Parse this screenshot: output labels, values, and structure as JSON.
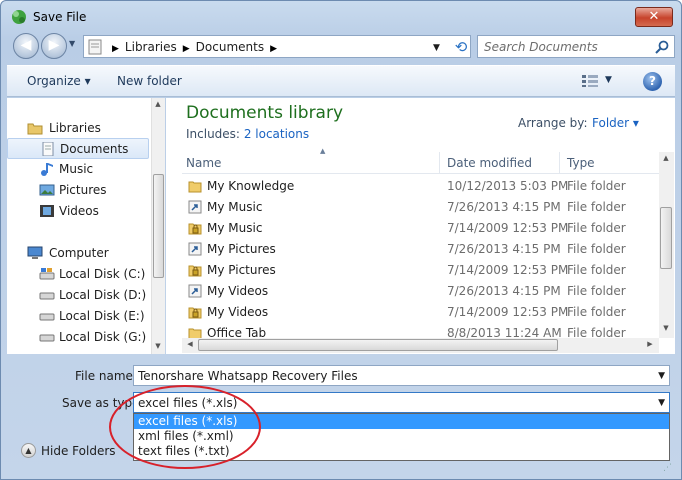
{
  "window": {
    "title": "Save File",
    "close_label": "✕"
  },
  "address_bar": {
    "segments": [
      "Libraries",
      "Documents"
    ],
    "search_placeholder": "Search Documents"
  },
  "toolbar": {
    "organize_label": "Organize",
    "new_folder_label": "New folder",
    "help_label": "?"
  },
  "nav_pane": {
    "items": [
      {
        "label": "Libraries",
        "icon": "libraries-icon"
      },
      {
        "label": "Documents",
        "icon": "documents-icon",
        "selected": true
      },
      {
        "label": "Music",
        "icon": "music-icon"
      },
      {
        "label": "Pictures",
        "icon": "pictures-icon"
      },
      {
        "label": "Videos",
        "icon": "videos-icon"
      },
      {
        "label": "Computer",
        "icon": "computer-icon"
      },
      {
        "label": "Local Disk (C:)",
        "icon": "drive-icon"
      },
      {
        "label": "Local Disk (D:)",
        "icon": "drive-icon"
      },
      {
        "label": "Local Disk (E:)",
        "icon": "drive-icon"
      },
      {
        "label": "Local Disk (G:)",
        "icon": "drive-icon"
      }
    ]
  },
  "library": {
    "title": "Documents library",
    "includes_label": "Includes:",
    "includes_link": "2 locations",
    "arrange_label": "Arrange by:",
    "arrange_value": "Folder"
  },
  "columns": {
    "name": "Name",
    "date": "Date modified",
    "type": "Type"
  },
  "files": [
    {
      "name": "My Knowledge",
      "date": "10/12/2013 5:03 PM",
      "type": "File folder",
      "icon": "folder-icon"
    },
    {
      "name": "My Music",
      "date": "7/26/2013 4:15 PM",
      "type": "File folder",
      "icon": "shortcut-folder-icon"
    },
    {
      "name": "My Music",
      "date": "7/14/2009 12:53 PM",
      "type": "File folder",
      "icon": "locked-folder-icon"
    },
    {
      "name": "My Pictures",
      "date": "7/26/2013 4:15 PM",
      "type": "File folder",
      "icon": "shortcut-folder-icon"
    },
    {
      "name": "My Pictures",
      "date": "7/14/2009 12:53 PM",
      "type": "File folder",
      "icon": "locked-folder-icon"
    },
    {
      "name": "My Videos",
      "date": "7/26/2013 4:15 PM",
      "type": "File folder",
      "icon": "shortcut-folder-icon"
    },
    {
      "name": "My Videos",
      "date": "7/14/2009 12:53 PM",
      "type": "File folder",
      "icon": "locked-folder-icon"
    },
    {
      "name": "Office Tab",
      "date": "8/8/2013 11:24 AM",
      "type": "File folder",
      "icon": "folder-icon"
    }
  ],
  "form": {
    "file_name_label": "File name:",
    "file_name_value": "Tenorshare Whatsapp Recovery Files",
    "save_type_label": "Save as type:",
    "save_type_value": "excel files (*.xls)",
    "type_options": [
      "excel files (*.xls)",
      "xml files (*.xml)",
      "text files (*.txt)"
    ],
    "hide_folders_label": "Hide Folders"
  },
  "colors": {
    "library_title": "#1e6f1e",
    "link": "#1a63c2",
    "highlight": "#3399ff",
    "annotation": "#d8212a"
  }
}
